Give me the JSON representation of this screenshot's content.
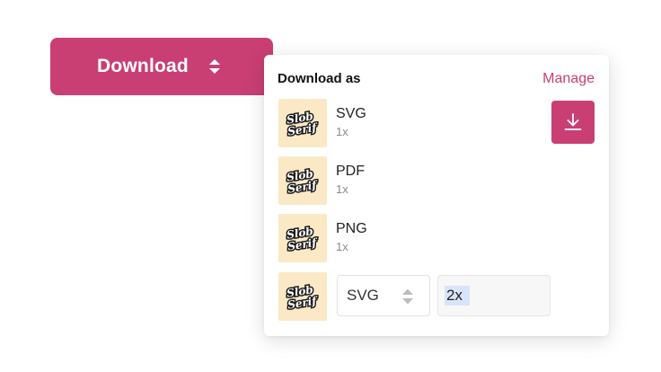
{
  "download_button": {
    "label": "Download",
    "icon": "sort-updown-icon",
    "color": "#c93f73"
  },
  "panel": {
    "title": "Download as",
    "manage_label": "Manage",
    "rows": [
      {
        "format": "SVG",
        "scale": "1x",
        "thumb": "Slob Serif"
      },
      {
        "format": "PDF",
        "scale": "1x",
        "thumb": "Slob Serif"
      },
      {
        "format": "PNG",
        "scale": "1x",
        "thumb": "Slob Serif"
      }
    ],
    "custom": {
      "thumb": "Slob Serif",
      "format_value": "SVG",
      "scale_value": "2x"
    },
    "download_icon": "download-icon"
  },
  "colors": {
    "accent": "#c93f73",
    "thumb_bg": "#fbe9c6",
    "selection": "#d9e4f8"
  }
}
